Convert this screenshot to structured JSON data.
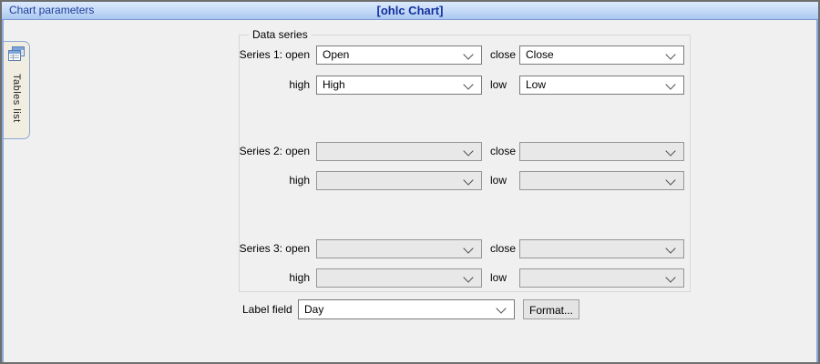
{
  "header": {
    "title_left": "Chart parameters",
    "title_center": "[ohlc Chart]"
  },
  "sidebar": {
    "tab": {
      "label": "Tables list",
      "icon": "tables-icon"
    }
  },
  "panel": {
    "group_label": "Data series",
    "series": [
      {
        "name_label": "Series 1: open",
        "open": "Open",
        "close_label": "close",
        "close": "Close",
        "high_label": "high",
        "high": "High",
        "low_label": "low",
        "low": "Low"
      },
      {
        "name_label": "Series 2: open",
        "open": "",
        "close_label": "close",
        "close": "",
        "high_label": "high",
        "high": "",
        "low_label": "low",
        "low": ""
      },
      {
        "name_label": "Series 3: open",
        "open": "",
        "close_label": "close",
        "close": "",
        "high_label": "high",
        "high": "",
        "low_label": "low",
        "low": ""
      }
    ],
    "label_field": {
      "label": "Label field",
      "value": "Day",
      "format_button_label": "Format..."
    }
  },
  "icons": {
    "tab_icon": "tables-icon",
    "combo_arrow": "chevron-down-icon"
  },
  "colors": {
    "accent_blue": "#8aa8d8",
    "header_gradient_top": "#dceafc",
    "header_gradient_bottom": "#a9c7f0",
    "header_text": "#1f3f9c",
    "tab_background": "#f1eee1",
    "body_background": "#f0f0f0",
    "window_border": "#6e6e6e"
  }
}
